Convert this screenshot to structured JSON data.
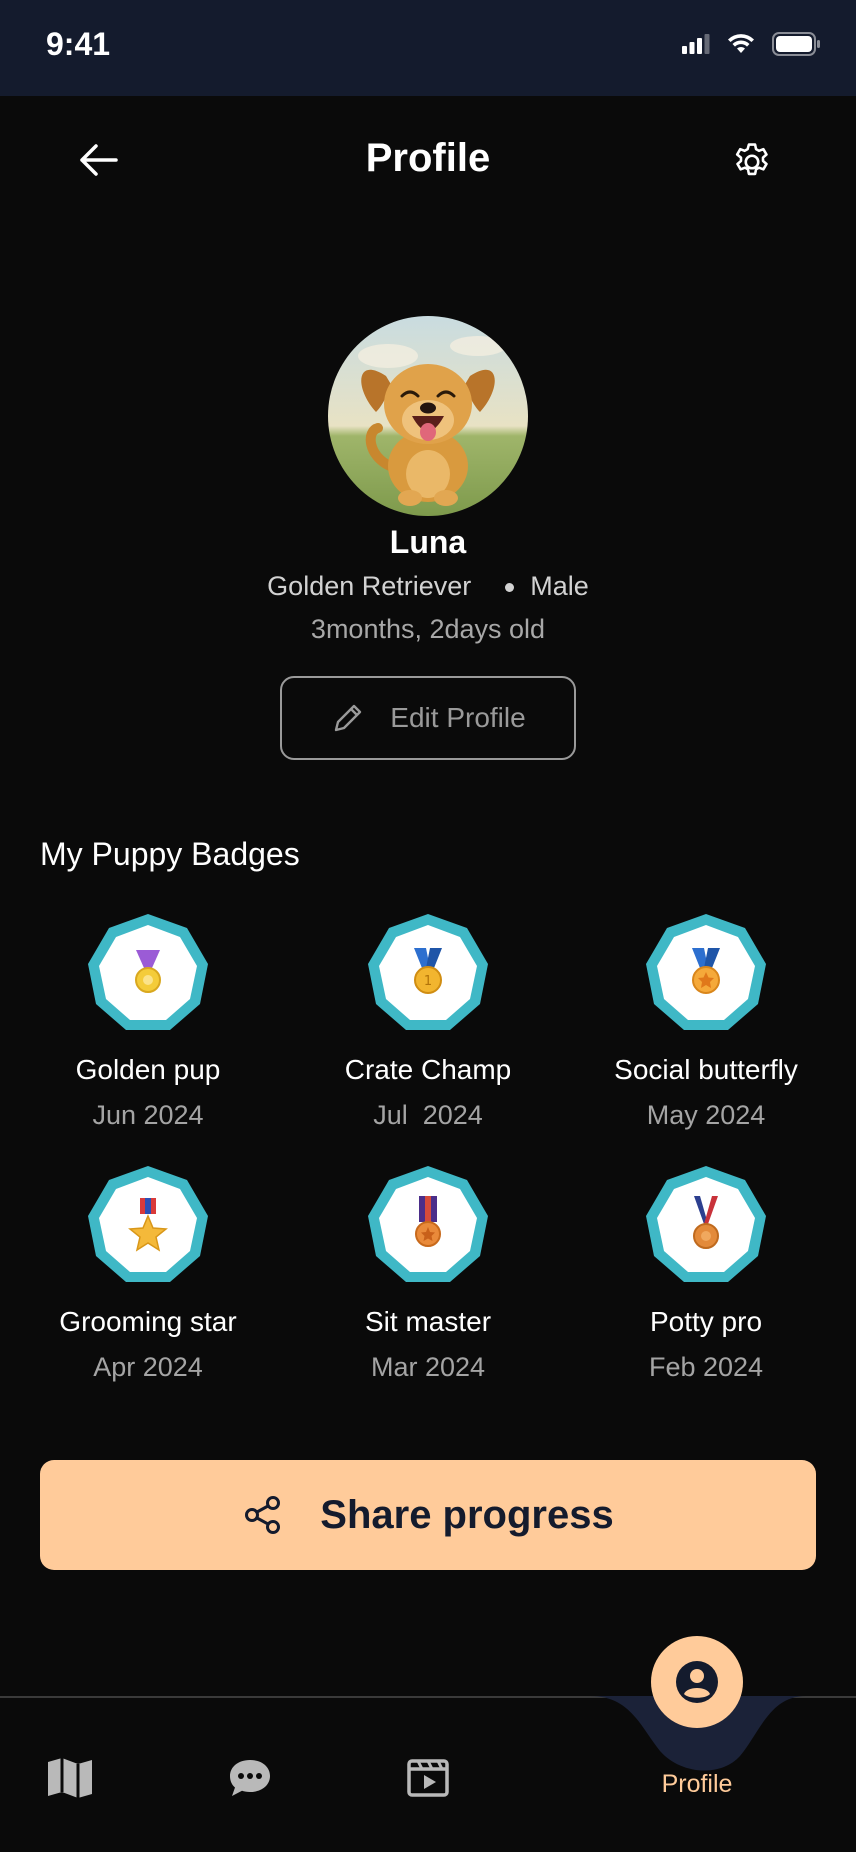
{
  "status_bar": {
    "time": "9:41"
  },
  "header": {
    "title": "Profile"
  },
  "profile": {
    "name": "Luna",
    "breed": "Golden Retriever",
    "sex": "Male",
    "age": "3months, 2days old",
    "edit_label": "Edit Profile"
  },
  "badges_section": {
    "title": "My Puppy Badges",
    "items": [
      {
        "name": "Golden pup",
        "date": "Jun 2024",
        "icon": "medal-purple-ribbon-icon"
      },
      {
        "name": "Crate Champ",
        "date": "Jul  2024",
        "icon": "medal-blue-ribbon-icon"
      },
      {
        "name": "Social butterfly",
        "date": "May 2024",
        "icon": "medal-star-blue-ribbon-icon"
      },
      {
        "name": "Grooming star",
        "date": "Apr 2024",
        "icon": "medal-star-military-icon"
      },
      {
        "name": "Sit master",
        "date": "Mar 2024",
        "icon": "medal-purple-stripe-icon"
      },
      {
        "name": "Potty pro",
        "date": "Feb 2024",
        "icon": "medal-bronze-ribbon-icon"
      }
    ]
  },
  "share": {
    "label": "Share progress"
  },
  "tab_bar": {
    "items": [
      {
        "icon": "map-icon"
      },
      {
        "icon": "chat-icon"
      },
      {
        "icon": "video-icon"
      },
      {
        "icon": "profile-icon",
        "label": "Profile",
        "active": true
      }
    ]
  },
  "colors": {
    "background": "#0a0a0a",
    "status_bar": "#141b2d",
    "accent": "#ffcb9a",
    "badge_ring": "#3fb8c6"
  }
}
